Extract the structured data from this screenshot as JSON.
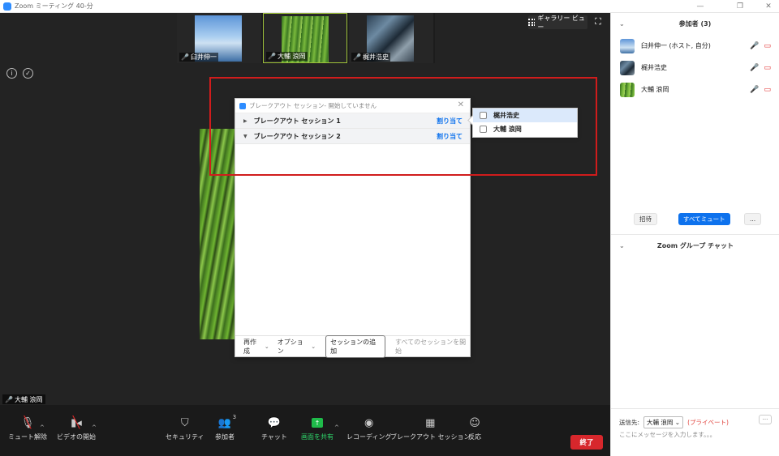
{
  "window": {
    "title": "Zoom ミーティング 40-分"
  },
  "thumbnails": [
    {
      "name": "臼井伸一"
    },
    {
      "name": "大輔 浪岡"
    },
    {
      "name": "梶井浩史"
    }
  ],
  "view": {
    "gallery_label": "ギャラリー ビュー"
  },
  "speaker": {
    "name": "大輔 浪岡"
  },
  "breakout": {
    "title": "ブレークアウト セッション- 開始していません",
    "sessions": [
      {
        "name": "ブレークアウト セッション 1",
        "assign": "割り当て"
      },
      {
        "name": "ブレークアウト セッション 2",
        "assign": "割り当て"
      }
    ],
    "footer": {
      "recreate": "再作成",
      "options": "オプション",
      "add_session": "セッションの追加",
      "open_all": "すべてのセッションを開始"
    }
  },
  "assign_popup": {
    "items": [
      {
        "name": "梶井浩史"
      },
      {
        "name": "大輔 浪岡"
      }
    ]
  },
  "toolbar": {
    "unmute": "ミュート解除",
    "start_video": "ビデオの開始",
    "security": "セキュリティ",
    "participants": "参加者",
    "participants_count": "3",
    "chat": "チャット",
    "share": "画面を共有",
    "record": "レコーディング",
    "breakout": "ブレークアウト セッション",
    "reactions": "反応",
    "end": "終了"
  },
  "panel": {
    "participants_title": "参加者 (3)",
    "participants": [
      {
        "name": "臼井伸一 (ホスト, 自分)"
      },
      {
        "name": "梶井浩史"
      },
      {
        "name": "大輔 浪岡"
      }
    ],
    "invite": "招待",
    "mute_all": "すべてミュート",
    "more": "...",
    "chat_title": "Zoom グループ チャット",
    "to_label": "送信先:",
    "to_value": "大輔 浪岡",
    "private": "(プライベート)",
    "chat_placeholder": "ここにメッセージを入力します。。。"
  },
  "colors": {
    "accent_blue": "#0e72ed",
    "end_red": "#d7272c",
    "share_green": "#1fbb4a",
    "highlight_red": "#d01c1c"
  }
}
